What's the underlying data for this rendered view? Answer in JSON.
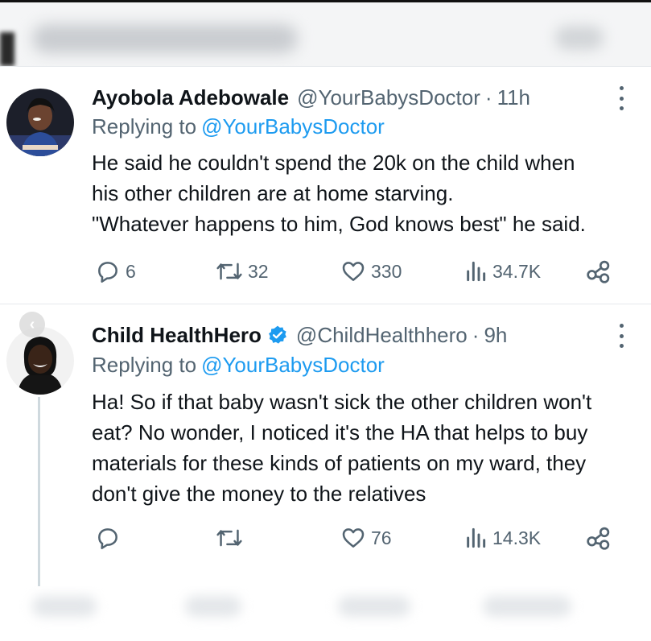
{
  "tweets": [
    {
      "name": "Ayobola Adebowale",
      "handle": "@YourBabysDoctor",
      "separator": "·",
      "time": "11h",
      "replying_prefix": "Replying to",
      "replying_to": "@YourBabysDoctor",
      "body_lines": [
        "He said he couldn't spend the 20k on the child when",
        "his other children are at home starving.",
        "\"Whatever happens to him, God knows best\" he said."
      ],
      "actions": {
        "reply_count": "6",
        "retweet_count": "32",
        "like_count": "330",
        "views_count": "34.7K"
      },
      "verified": false
    },
    {
      "name": "Child HealthHero",
      "handle": "@ChildHealthhero",
      "separator": "·",
      "time": "9h",
      "replying_prefix": "Replying to",
      "replying_to": "@YourBabysDoctor",
      "body_lines": [
        "Ha! So if that baby wasn't sick the other children won't",
        "eat? No wonder, I noticed it's the HA that helps to buy",
        "materials for these kinds of patients on my ward, they",
        "don't give the money to the relatives"
      ],
      "actions": {
        "reply_count": "",
        "retweet_count": "",
        "like_count": "76",
        "views_count": "14.3K"
      },
      "verified": true
    }
  ],
  "icons": {
    "reply": "reply-icon",
    "retweet": "retweet-icon",
    "like": "heart-icon",
    "views": "views-icon",
    "share": "share-icon",
    "more": "more-icon",
    "verified": "verified-badge-icon",
    "back": "back-chevron-icon"
  },
  "colors": {
    "text": "#0f1419",
    "secondary": "#536471",
    "mention": "#1d9bf0",
    "verified": "#1d9bf0",
    "divider": "#e6e9ec"
  }
}
